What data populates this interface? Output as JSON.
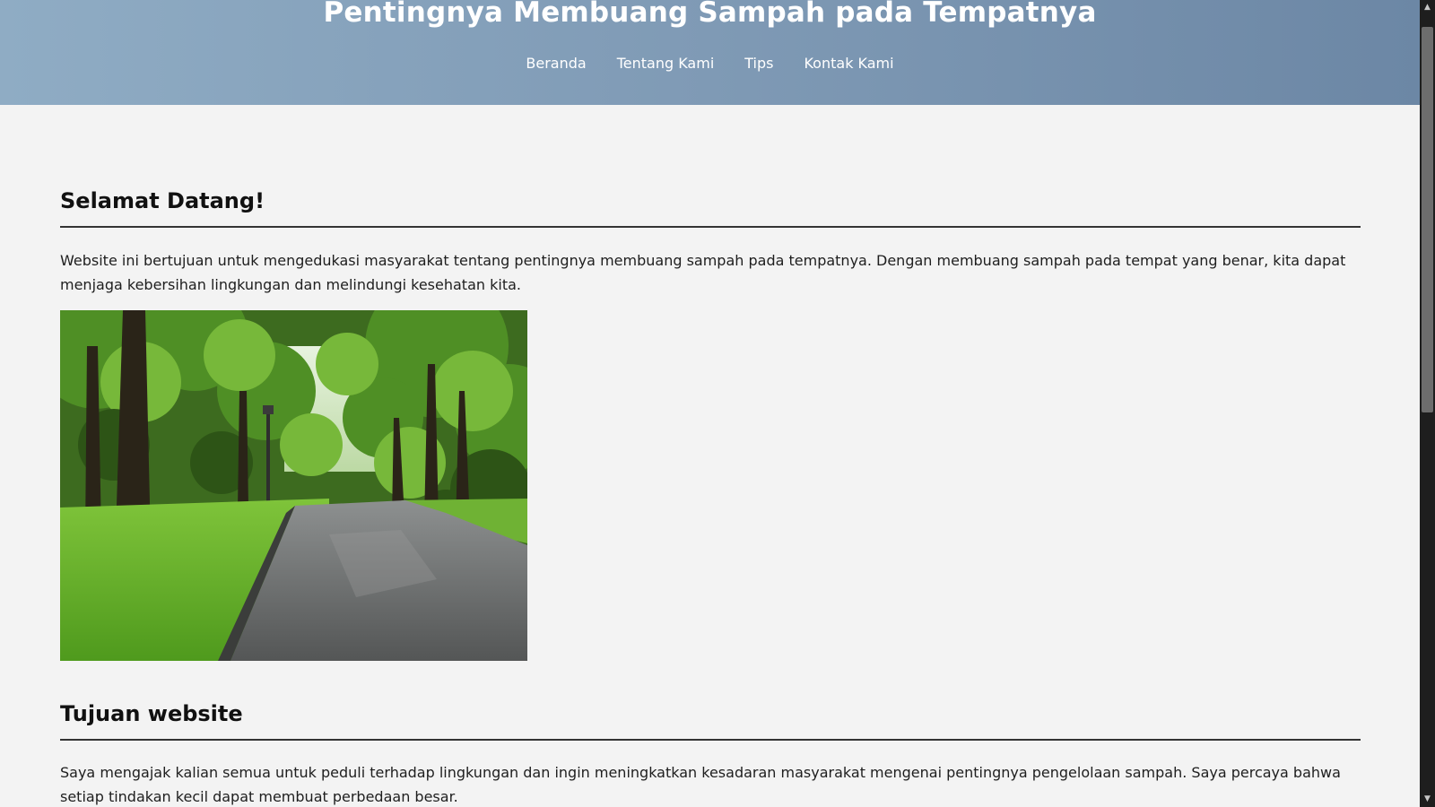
{
  "header": {
    "title": "Pentingnya Membuang Sampah pada Tempatnya",
    "nav": [
      {
        "label": "Beranda"
      },
      {
        "label": "Tentang Kami"
      },
      {
        "label": "Tips"
      },
      {
        "label": "Kontak Kami"
      }
    ]
  },
  "welcome": {
    "heading": "Selamat Datang!",
    "paragraph": "Website ini bertujuan untuk mengedukasi masyarakat tentang pentingnya membuang sampah pada tempatnya. Dengan membuang sampah pada tempat yang benar, kita dapat menjaga kebersihan lingkungan dan melindungi kesehatan kita."
  },
  "goal": {
    "heading": "Tujuan website",
    "paragraph": "Saya mengajak kalian semua untuk peduli terhadap lingkungan dan ingin meningkatkan kesadaran masyarakat mengenai pentingnya pengelolaan sampah. Saya percaya bahwa setiap tindakan kecil dapat membuat perbedaan besar."
  },
  "colors": {
    "header_start": "#8facc4",
    "header_end": "#6c87a5",
    "page_background": "#f3f3f3",
    "text": "#1e1e1e"
  },
  "icons": {
    "scroll_up": "scroll-up-arrow-icon",
    "scroll_down": "scroll-down-arrow-icon"
  }
}
